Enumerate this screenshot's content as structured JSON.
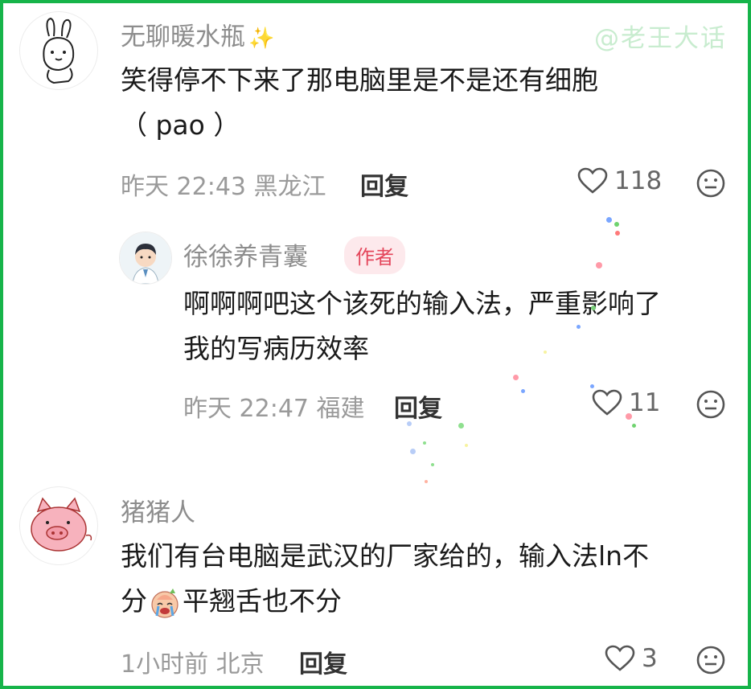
{
  "watermark": "@老王大话",
  "comments": [
    {
      "username": "无聊暖水瓶",
      "username_suffix": "✨",
      "text_line1": "笑得停不下来了那电脑里是不是还有细胞",
      "text_line2": "（ pao ）",
      "time": "昨天 22:43",
      "location": "黑龙江",
      "reply_label": "回复",
      "likes": "118"
    },
    {
      "username": "徐徐养青囊",
      "author_tag": "作者",
      "text_line1": "啊啊啊吧这个该死的输入法，严重影响了",
      "text_line2": "我的写病历效率",
      "time": "昨天 22:47",
      "location": "福建",
      "reply_label": "回复",
      "likes": "11"
    },
    {
      "username": "猪猪人",
      "text_line1": "我们有台电脑是武汉的厂家给的，输入法ln不",
      "text_line2_before": "分",
      "text_line2_after": "平翘舌也不分",
      "time": "1小时前",
      "location": "北京",
      "reply_label": "回复",
      "likes": "3"
    }
  ],
  "colors": {
    "border": "#16b44a",
    "author_tag_bg": "#fde9ec",
    "author_tag_text": "#e4465b"
  },
  "icons": [
    "heart-outline-icon",
    "neutral-face-icon",
    "crying-emoji-icon"
  ]
}
